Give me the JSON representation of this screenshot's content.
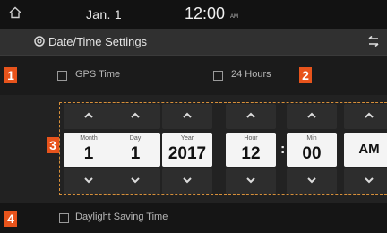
{
  "status_bar": {
    "date": "Jan.  1",
    "time": "12:00",
    "time_suffix": "AM",
    "home_icon": "home-icon"
  },
  "title_bar": {
    "title": "Date/Time Settings",
    "title_icon": "gear-icon",
    "back_icon": "back-arrow-icon"
  },
  "options": {
    "gps_time": {
      "marker": "1",
      "label": "GPS Time",
      "checked": false
    },
    "hours_24": {
      "marker": "2",
      "label": "24 Hours",
      "checked": false
    },
    "daylight_saving": {
      "marker": "4",
      "label": "Daylight Saving Time",
      "checked": false
    }
  },
  "picker": {
    "marker": "3",
    "month": {
      "label": "Month",
      "value": "1"
    },
    "day": {
      "label": "Day",
      "value": "1"
    },
    "year": {
      "label": "Year",
      "value": "2017"
    },
    "hour": {
      "label": "Hour",
      "value": "12"
    },
    "minute": {
      "label": "Min",
      "value": "00"
    },
    "ampm": {
      "value": "AM"
    },
    "separator": ":"
  },
  "colors": {
    "marker": "#e8541c",
    "frame": "#d8903a",
    "background": "#1b1b1b",
    "value_box": "#f4f4f4"
  }
}
